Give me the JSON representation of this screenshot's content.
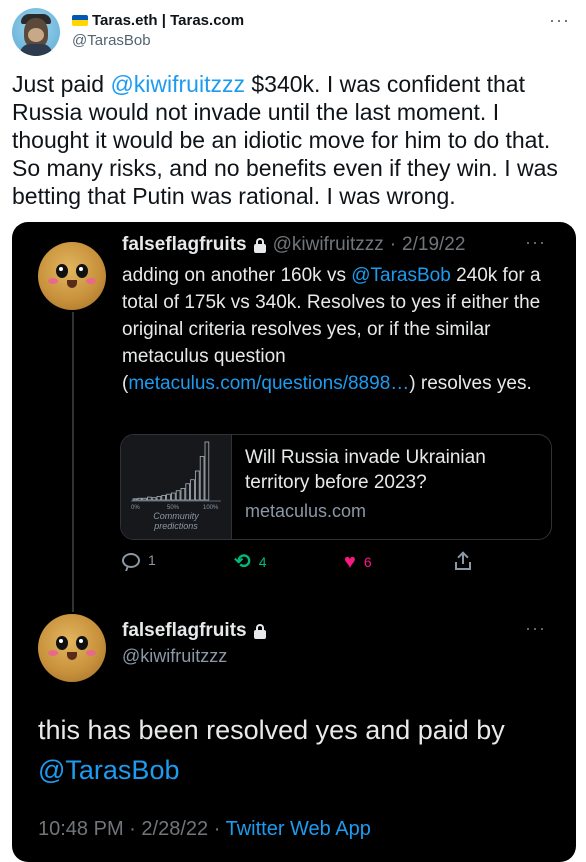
{
  "author": {
    "display_name": "Taras.eth | Taras.com",
    "handle": "@TarasBob",
    "more_icon": "more-horizontal-icon"
  },
  "tweet": {
    "text_before": "Just paid ",
    "mention": "@kiwifruitzzz",
    "text_after": " $340k. I was confident that Russia would not invade until the last moment. I thought it would be an idiotic move for him to do that. So many risks, and no benefits even if they win. I was betting that Putin was rational. I was wrong."
  },
  "quoted_tweet": {
    "name": "falseflagfruits",
    "handle": "@kiwifruitzzz",
    "date_sep": "·",
    "date": "2/19/22",
    "text_1": "adding on another 160k vs ",
    "mention": "@TarasBob",
    "text_2": " 240k for a total of 175k vs 340k. Resolves to yes if either the original criteria resolves yes, or if the similar metaculus question (",
    "link": "metaculus.com/questions/8898…",
    "text_3": ") resolves yes.",
    "card": {
      "title": "Will Russia invade Ukrainian territory before 2023?",
      "domain": "metaculus.com",
      "thumb_axis_0": "0%",
      "thumb_axis_50": "50%",
      "thumb_axis_100": "100%",
      "thumb_caption_1": "Community",
      "thumb_caption_2": "predictions"
    },
    "stats": {
      "replies": "1",
      "retweets": "4",
      "likes": "6"
    }
  },
  "reply": {
    "name": "falseflagfruits",
    "handle": "@kiwifruitzzz",
    "text_before": "this has been resolved yes and paid by ",
    "mention": "@TarasBob",
    "time": "10:48 PM",
    "sep": "·",
    "date": "2/28/22",
    "sep2": "·",
    "client": "Twitter Web App"
  },
  "colors": {
    "link": "#1d9bf0",
    "retweet": "#00ba7c",
    "like": "#f91880"
  },
  "histogram_bars": [
    0.02,
    0.03,
    0.03,
    0.05,
    0.04,
    0.06,
    0.08,
    0.1,
    0.12,
    0.16,
    0.2,
    0.28,
    0.35,
    0.5,
    0.75,
    1.0
  ]
}
